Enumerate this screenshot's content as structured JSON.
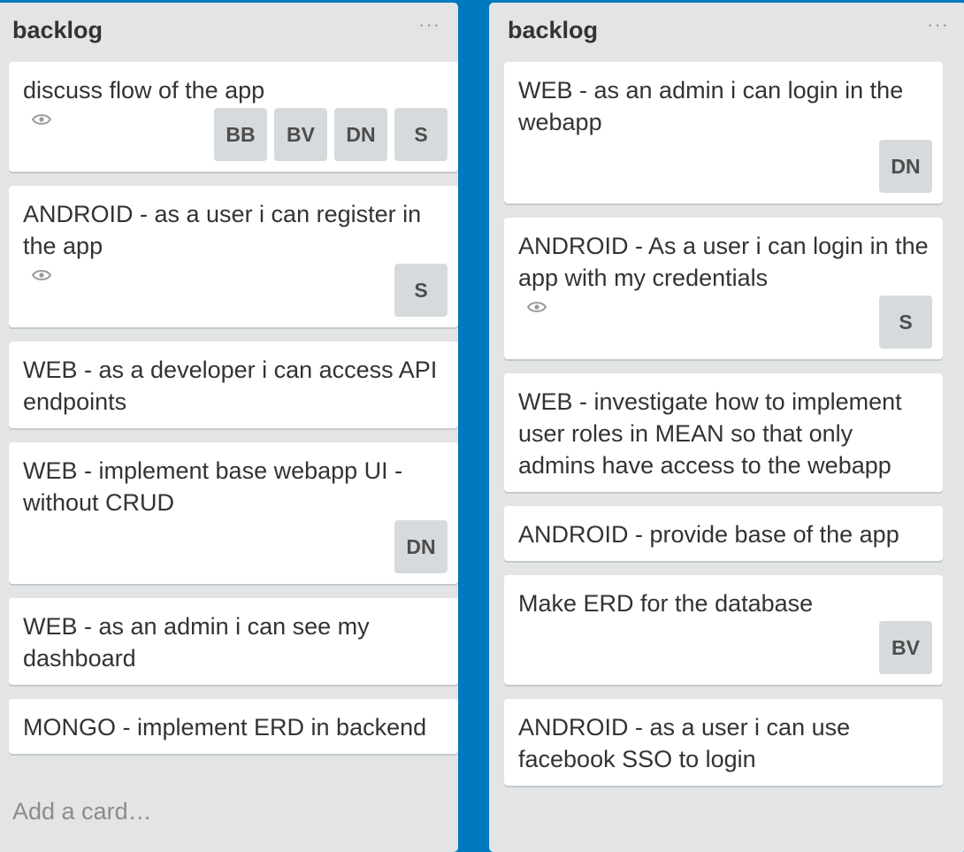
{
  "colors": {
    "board_background": "#0079bf",
    "list_background": "#e2e4e6",
    "card_background": "#ffffff",
    "member_badge": "#d6dadc"
  },
  "lists": [
    {
      "title": "backlog",
      "menu": "···",
      "add_card": "Add a card…",
      "cards": [
        {
          "title": "discuss flow of the app",
          "watching": true,
          "members": [
            "BB",
            "BV",
            "DN",
            "S"
          ]
        },
        {
          "title": "ANDROID - as a user i can register in the app",
          "watching": true,
          "members": [
            "S"
          ]
        },
        {
          "title": "WEB - as a developer i can access API endpoints",
          "watching": false,
          "members": []
        },
        {
          "title": "WEB - implement base webapp UI - without CRUD",
          "watching": false,
          "members": [
            "DN"
          ]
        },
        {
          "title": "WEB - as an admin i can see my dashboard",
          "watching": false,
          "members": []
        },
        {
          "title": "MONGO - implement ERD in backend",
          "watching": false,
          "members": []
        }
      ]
    },
    {
      "title": "backlog",
      "menu": "···",
      "cards": [
        {
          "title": "WEB - as an admin i can login in the webapp",
          "watching": false,
          "members": [
            "DN"
          ]
        },
        {
          "title": "ANDROID - As a user i can login in the app with my credentials",
          "watching": true,
          "members": [
            "S"
          ]
        },
        {
          "title": "WEB - investigate how to implement user roles in MEAN so that only admins have access to the webapp",
          "watching": false,
          "members": []
        },
        {
          "title": "ANDROID - provide base of the app",
          "watching": false,
          "members": []
        },
        {
          "title": "Make ERD for the database",
          "watching": false,
          "members": [
            "BV"
          ]
        },
        {
          "title": "ANDROID - as a user i can use facebook SSO to login",
          "watching": false,
          "members": []
        }
      ]
    }
  ]
}
